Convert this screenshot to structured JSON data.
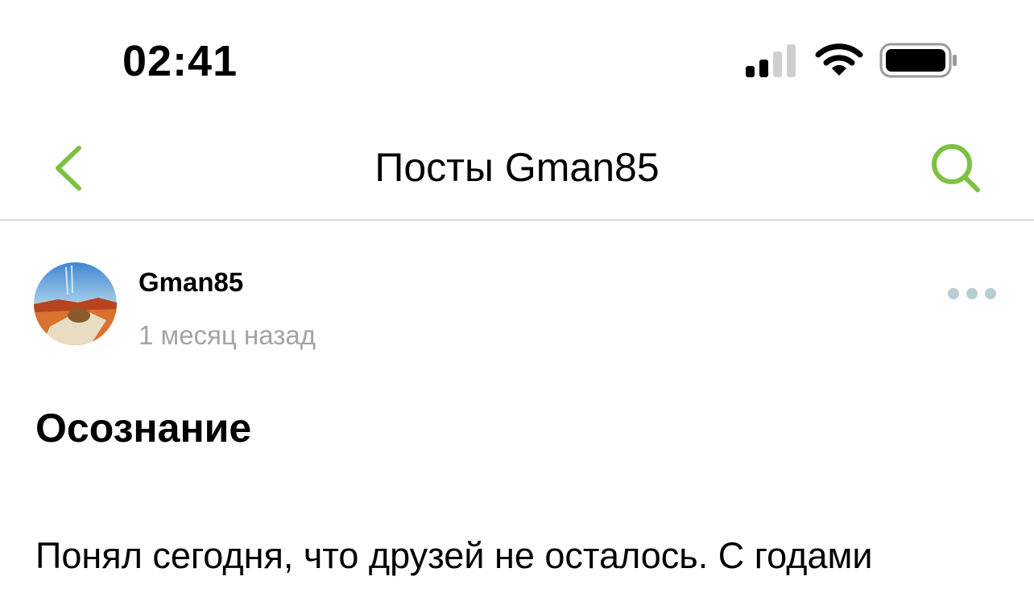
{
  "status_bar": {
    "time": "02:41",
    "signal_icon": "cellular-signal-icon",
    "wifi_icon": "wifi-icon",
    "battery_icon": "battery-icon"
  },
  "nav": {
    "back_icon": "chevron-left-icon",
    "title": "Посты Gman85",
    "search_icon": "search-icon"
  },
  "post": {
    "author": "Gman85",
    "time_ago": "1 месяц назад",
    "more_icon": "more-dots-icon",
    "title": "Осознание",
    "body": "Понял сегодня, что друзей не осталось. С годами"
  },
  "colors": {
    "accent": "#7cc242",
    "muted": "#a3a3a8",
    "dots": "#b9cdd1",
    "divider": "#e4e4e6"
  }
}
